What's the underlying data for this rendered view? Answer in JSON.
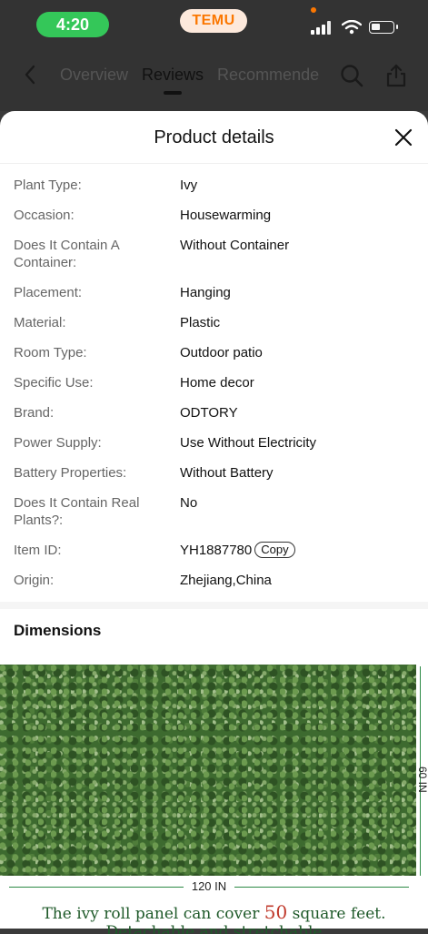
{
  "status_bar": {
    "time": "4:20",
    "app_badge": "TEMU"
  },
  "nav": {
    "tabs": [
      {
        "label": "Overview",
        "active": false
      },
      {
        "label": "Reviews",
        "active": true
      },
      {
        "label": "Recommende",
        "active": false
      }
    ],
    "icons": [
      "back-icon",
      "search-icon",
      "share-icon"
    ]
  },
  "sheet": {
    "title": "Product details",
    "close_icon": "close-icon",
    "details": [
      {
        "key": "Plant Type:",
        "value": "Ivy"
      },
      {
        "key": "Occasion:",
        "value": "Housewarming"
      },
      {
        "key": "Does It Contain A Container:",
        "value": "Without Container"
      },
      {
        "key": "Placement:",
        "value": "Hanging"
      },
      {
        "key": "Material:",
        "value": "Plastic"
      },
      {
        "key": "Room Type:",
        "value": "Outdoor patio"
      },
      {
        "key": "Specific Use:",
        "value": "Home decor"
      },
      {
        "key": "Brand:",
        "value": "ODTORY"
      },
      {
        "key": "Power Supply:",
        "value": "Use Without Electricity"
      },
      {
        "key": "Battery Properties:",
        "value": "Without Battery"
      },
      {
        "key": "Does It Contain Real Plants?:",
        "value": "No"
      },
      {
        "key": "Item ID:",
        "value": "YH1887780",
        "action": "Copy"
      },
      {
        "key": "Origin:",
        "value": "Zhejiang,China"
      }
    ],
    "dimensions_title": "Dimensions",
    "dimension_image": {
      "height_label": "60 IN",
      "width_label": "120 IN",
      "caption_before": "The ivy roll panel can cover ",
      "caption_number": "50",
      "caption_after": " square feet.",
      "caption_line2": "Detachable and stretchable"
    }
  },
  "colors": {
    "accent_green": "#34c759",
    "brand_orange": "#fb7701",
    "ivy_green": "#3d6a2f"
  }
}
